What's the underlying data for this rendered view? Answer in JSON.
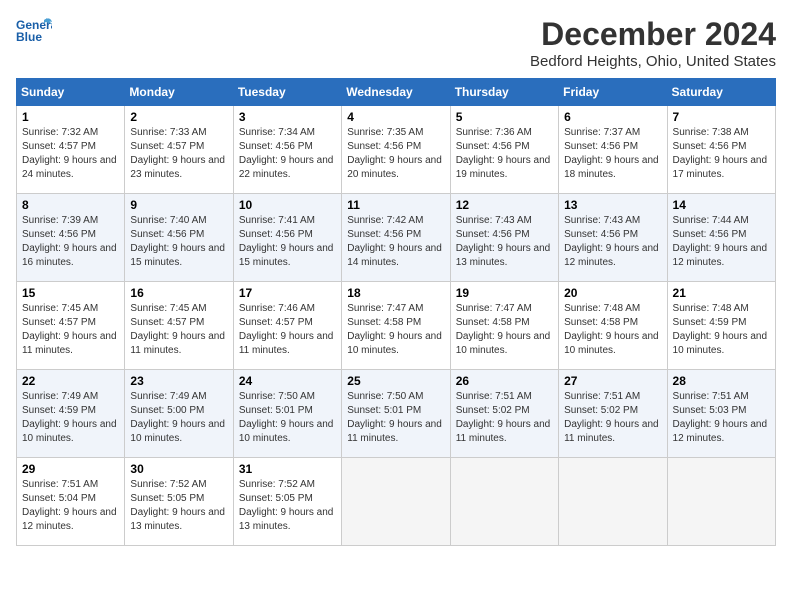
{
  "header": {
    "logo_line1": "General",
    "logo_line2": "Blue",
    "month_title": "December 2024",
    "location": "Bedford Heights, Ohio, United States"
  },
  "weekdays": [
    "Sunday",
    "Monday",
    "Tuesday",
    "Wednesday",
    "Thursday",
    "Friday",
    "Saturday"
  ],
  "weeks": [
    [
      {
        "day": "1",
        "sunrise": "7:32 AM",
        "sunset": "4:57 PM",
        "daylight": "9 hours and 24 minutes."
      },
      {
        "day": "2",
        "sunrise": "7:33 AM",
        "sunset": "4:57 PM",
        "daylight": "9 hours and 23 minutes."
      },
      {
        "day": "3",
        "sunrise": "7:34 AM",
        "sunset": "4:56 PM",
        "daylight": "9 hours and 22 minutes."
      },
      {
        "day": "4",
        "sunrise": "7:35 AM",
        "sunset": "4:56 PM",
        "daylight": "9 hours and 20 minutes."
      },
      {
        "day": "5",
        "sunrise": "7:36 AM",
        "sunset": "4:56 PM",
        "daylight": "9 hours and 19 minutes."
      },
      {
        "day": "6",
        "sunrise": "7:37 AM",
        "sunset": "4:56 PM",
        "daylight": "9 hours and 18 minutes."
      },
      {
        "day": "7",
        "sunrise": "7:38 AM",
        "sunset": "4:56 PM",
        "daylight": "9 hours and 17 minutes."
      }
    ],
    [
      {
        "day": "8",
        "sunrise": "7:39 AM",
        "sunset": "4:56 PM",
        "daylight": "9 hours and 16 minutes."
      },
      {
        "day": "9",
        "sunrise": "7:40 AM",
        "sunset": "4:56 PM",
        "daylight": "9 hours and 15 minutes."
      },
      {
        "day": "10",
        "sunrise": "7:41 AM",
        "sunset": "4:56 PM",
        "daylight": "9 hours and 15 minutes."
      },
      {
        "day": "11",
        "sunrise": "7:42 AM",
        "sunset": "4:56 PM",
        "daylight": "9 hours and 14 minutes."
      },
      {
        "day": "12",
        "sunrise": "7:43 AM",
        "sunset": "4:56 PM",
        "daylight": "9 hours and 13 minutes."
      },
      {
        "day": "13",
        "sunrise": "7:43 AM",
        "sunset": "4:56 PM",
        "daylight": "9 hours and 12 minutes."
      },
      {
        "day": "14",
        "sunrise": "7:44 AM",
        "sunset": "4:56 PM",
        "daylight": "9 hours and 12 minutes."
      }
    ],
    [
      {
        "day": "15",
        "sunrise": "7:45 AM",
        "sunset": "4:57 PM",
        "daylight": "9 hours and 11 minutes."
      },
      {
        "day": "16",
        "sunrise": "7:45 AM",
        "sunset": "4:57 PM",
        "daylight": "9 hours and 11 minutes."
      },
      {
        "day": "17",
        "sunrise": "7:46 AM",
        "sunset": "4:57 PM",
        "daylight": "9 hours and 11 minutes."
      },
      {
        "day": "18",
        "sunrise": "7:47 AM",
        "sunset": "4:58 PM",
        "daylight": "9 hours and 10 minutes."
      },
      {
        "day": "19",
        "sunrise": "7:47 AM",
        "sunset": "4:58 PM",
        "daylight": "9 hours and 10 minutes."
      },
      {
        "day": "20",
        "sunrise": "7:48 AM",
        "sunset": "4:58 PM",
        "daylight": "9 hours and 10 minutes."
      },
      {
        "day": "21",
        "sunrise": "7:48 AM",
        "sunset": "4:59 PM",
        "daylight": "9 hours and 10 minutes."
      }
    ],
    [
      {
        "day": "22",
        "sunrise": "7:49 AM",
        "sunset": "4:59 PM",
        "daylight": "9 hours and 10 minutes."
      },
      {
        "day": "23",
        "sunrise": "7:49 AM",
        "sunset": "5:00 PM",
        "daylight": "9 hours and 10 minutes."
      },
      {
        "day": "24",
        "sunrise": "7:50 AM",
        "sunset": "5:01 PM",
        "daylight": "9 hours and 10 minutes."
      },
      {
        "day": "25",
        "sunrise": "7:50 AM",
        "sunset": "5:01 PM",
        "daylight": "9 hours and 11 minutes."
      },
      {
        "day": "26",
        "sunrise": "7:51 AM",
        "sunset": "5:02 PM",
        "daylight": "9 hours and 11 minutes."
      },
      {
        "day": "27",
        "sunrise": "7:51 AM",
        "sunset": "5:02 PM",
        "daylight": "9 hours and 11 minutes."
      },
      {
        "day": "28",
        "sunrise": "7:51 AM",
        "sunset": "5:03 PM",
        "daylight": "9 hours and 12 minutes."
      }
    ],
    [
      {
        "day": "29",
        "sunrise": "7:51 AM",
        "sunset": "5:04 PM",
        "daylight": "9 hours and 12 minutes."
      },
      {
        "day": "30",
        "sunrise": "7:52 AM",
        "sunset": "5:05 PM",
        "daylight": "9 hours and 13 minutes."
      },
      {
        "day": "31",
        "sunrise": "7:52 AM",
        "sunset": "5:05 PM",
        "daylight": "9 hours and 13 minutes."
      },
      null,
      null,
      null,
      null
    ]
  ],
  "labels": {
    "sunrise": "Sunrise:",
    "sunset": "Sunset:",
    "daylight": "Daylight:"
  }
}
